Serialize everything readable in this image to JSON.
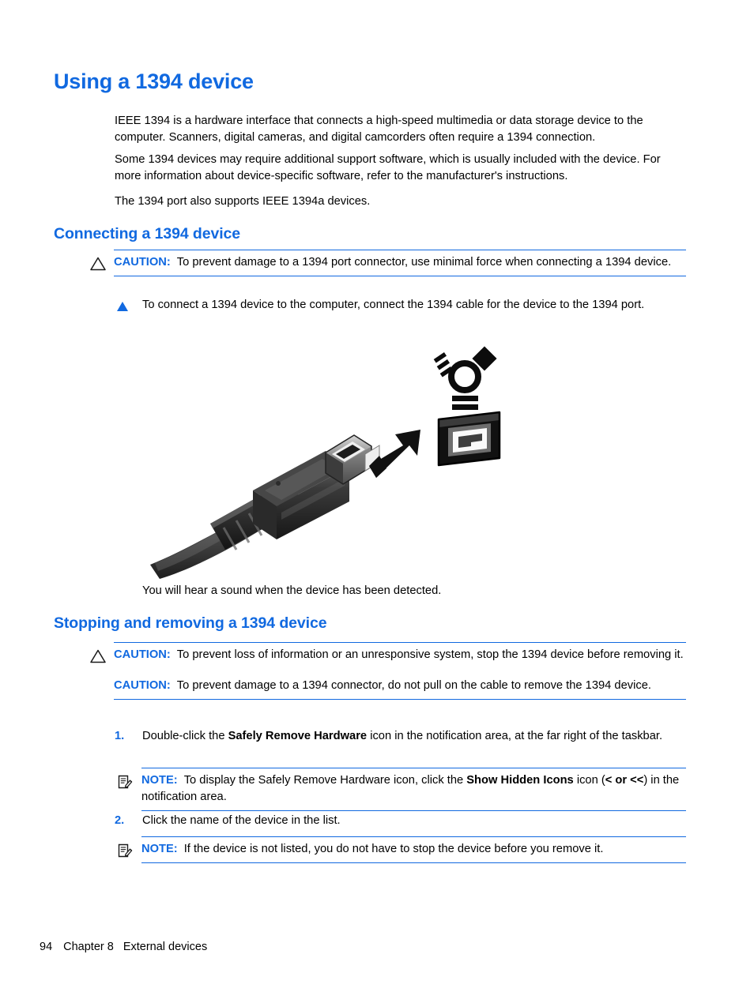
{
  "page": {
    "title": "Using a 1394 device",
    "accent_color": "#1169e0",
    "text_color": "#000000",
    "background_color": "#ffffff"
  },
  "headings": {
    "h1": "Using a 1394 device",
    "connecting": "Connecting a 1394 device",
    "stopping": "Stopping and removing a 1394 device"
  },
  "intro": {
    "p1": "IEEE 1394 is a hardware interface that connects a high-speed multimedia or data storage device to the computer. Scanners, digital cameras, and digital camcorders often require a 1394 connection.",
    "p2": "Some 1394 devices may require additional support software, which is usually included with the device. For more information about device-specific software, refer to the manufacturer's instructions.",
    "p3": "The 1394 port also supports IEEE 1394a devices."
  },
  "caution_connect": {
    "label": "CAUTION:",
    "text": "To prevent damage to a 1394 port connector, use minimal force when connecting a 1394 device.",
    "icon": "caution-triangle-icon"
  },
  "connect_step": {
    "bullet": "triangle-bullet-icon",
    "text": "To connect a 1394 device to the computer, connect the 1394 cable for the device to the 1394 port."
  },
  "illustration": {
    "name": "1394-cable-connecting-to-port-illustration",
    "alt": "A 1394 (FireWire) cable connector with an arrow pointing toward the 1394 port symbol and port receptacle"
  },
  "after_image": {
    "text": "You will hear a sound when the device has been detected."
  },
  "caution_stopping": {
    "label": "CAUTION:",
    "text_1": "To prevent loss of information or an unresponsive system, stop the 1394 device before removing it.",
    "label_2": "CAUTION:",
    "text_2": "To prevent damage to a 1394 connector, do not pull on the cable to remove the 1394 device.",
    "icon": "caution-triangle-icon"
  },
  "steps": [
    {
      "number": "1.",
      "text_before": "Double-click the ",
      "bold": "Safely Remove Hardware",
      "text_after": " icon in the notification area, at the far right of the taskbar."
    },
    {
      "number": "2.",
      "text_before": "Click the name of the device in the list.",
      "bold": "",
      "text_after": ""
    }
  ],
  "note_hidden_icons": {
    "label": "NOTE:",
    "text_before": "To display the Safely Remove Hardware icon, click the ",
    "bold": "Show Hidden Icons",
    "text_after": " icon (",
    "bold2": "< or <<",
    "text_after2": ") in the notification area.",
    "icon": "note-icon"
  },
  "note_not_listed": {
    "label": "NOTE:",
    "text": "If the device is not listed, you do not have to stop the device before you remove it.",
    "icon": "note-icon"
  },
  "footer": {
    "page_number": "94",
    "chapter": "Chapter 8",
    "chapter_title": "External devices"
  }
}
